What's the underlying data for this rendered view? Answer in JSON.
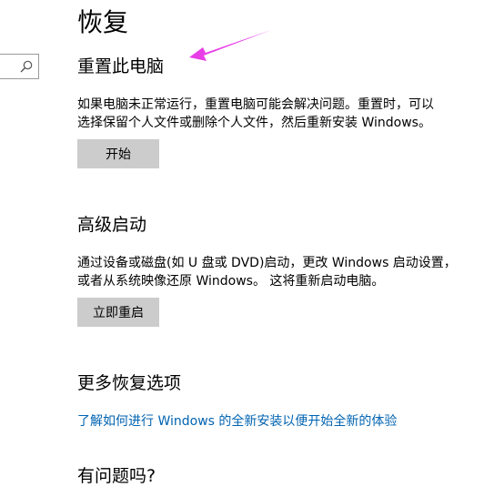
{
  "header": {
    "title": "恢复"
  },
  "search": {
    "icon": "search-icon"
  },
  "reset": {
    "title": "重置此电脑",
    "line1": "如果电脑未正常运行，重置电脑可能会解决问题。重置时，可以",
    "line2": "选择保留个人文件或删除个人文件，然后重新安装 Windows。",
    "button_label": "开始"
  },
  "advanced": {
    "title": "高级启动",
    "line1": "通过设备或磁盘(如 U 盘或 DVD)启动，更改 Windows 启动设置，",
    "line2": "或者从系统映像还原 Windows。 这将重新启动电脑。",
    "button_label": "立即重启"
  },
  "more": {
    "title": "更多恢复选项",
    "link": "了解如何进行 Windows 的全新安装以便开始全新的体验"
  },
  "help": {
    "title": "有问题吗?"
  },
  "colors": {
    "link": "#0063b1",
    "button_bg": "#cccccc",
    "annotation_arrow": "#e83ee8"
  }
}
